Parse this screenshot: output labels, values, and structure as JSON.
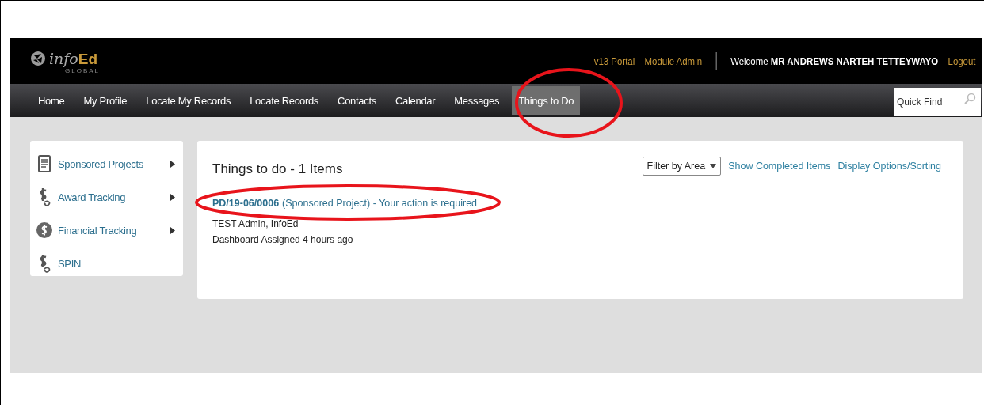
{
  "header": {
    "logo": {
      "text": "info",
      "accent": "Ed",
      "sub": "GLOBAL"
    },
    "links": [
      "v13 Portal",
      "Module Admin"
    ],
    "welcome": {
      "label": "Welcome",
      "user": "MR ANDREWS NARTEH TETTEYWAYO"
    },
    "logout": "Logout"
  },
  "nav": [
    {
      "label": "Home",
      "selected": false
    },
    {
      "label": "My Profile",
      "selected": false
    },
    {
      "label": "Locate My Records",
      "selected": false
    },
    {
      "label": "Locate Records",
      "selected": false
    },
    {
      "label": "Contacts",
      "selected": false
    },
    {
      "label": "Calendar",
      "selected": false
    },
    {
      "label": "Messages",
      "selected": false
    },
    {
      "label": "Things to Do",
      "selected": true
    }
  ],
  "search": {
    "placeholder": "Quick Find"
  },
  "sidebar": {
    "items": [
      {
        "label": "Sponsored Projects",
        "kind": "document",
        "expandable": true
      },
      {
        "label": "Award Tracking",
        "kind": "dollar",
        "expandable": true
      },
      {
        "label": "Financial Tracking",
        "kind": "coin",
        "expandable": true
      },
      {
        "label": "SPIN",
        "kind": "dollar",
        "expandable": false
      }
    ]
  },
  "panel": {
    "title": "Things to do - 1 Items",
    "filter": "Filter by Area",
    "links": [
      "Show Completed Items",
      "Display Options/Sorting"
    ],
    "items": [
      {
        "id": "PD/19-06/0006",
        "text": "(Sponsored Project) - Your action is required",
        "owner": "TEST Admin, InfoEd",
        "meta": "Dashboard Assigned 4 hours ago"
      }
    ]
  }
}
